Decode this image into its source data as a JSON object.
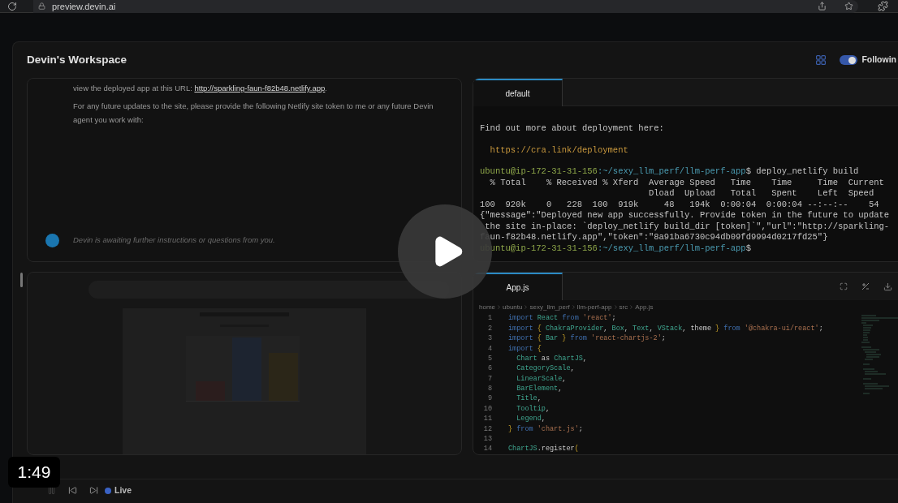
{
  "browser": {
    "url": "preview.devin.ai"
  },
  "workspace": {
    "title": "Devin's Workspace",
    "following": {
      "label": "Followin",
      "on": true
    }
  },
  "chat": {
    "paragraphs": [
      {
        "text": "view the deployed app at this URL: ",
        "link": "http://sparkling-faun-f82b48.netlify.app",
        "after": "."
      },
      {
        "text": "For any future updates to the site, please provide the following Netlify site token to me or any future Devin agent you work with:"
      }
    ],
    "status": "Devin is awaiting further instructions or questions from you."
  },
  "terminal": {
    "tabs": [
      {
        "label": "default",
        "selected": true
      }
    ],
    "lines": [
      {
        "kind": "text",
        "text": "Find out more about deployment here:"
      },
      {
        "kind": "link",
        "text": "  https://cra.link/deployment"
      },
      {
        "kind": "prompt",
        "user": "ubuntu@ip-172-31-31-156",
        "path": ":~/sexy_llm_perf/llm-perf-app",
        "text": "$ deploy_netlify build"
      },
      {
        "kind": "text",
        "text": "  % Total    % Received % Xferd  Average Speed   Time    Time     Time  Current"
      },
      {
        "kind": "text",
        "text": "                                 Dload  Upload   Total   Spent    Left  Speed"
      },
      {
        "kind": "text",
        "text": "100  920k    0   228  100  919k     48   194k  0:00:04  0:00:04 --:--:--    54"
      },
      {
        "kind": "text",
        "text": "{\"message\":\"Deployed new app successfully. Provide token in the future to update"
      },
      {
        "kind": "text",
        "text": " the site in-place: `deploy_netlify build_dir [token]`\",\"url\":\"http://sparkling-"
      },
      {
        "kind": "text",
        "text": "faun-f82b48.netlify.app\",\"token\":\"8a91ba6730c94db09fd9994d0217fd25\"}"
      },
      {
        "kind": "prompt",
        "user": "ubuntu@ip-172-31-31-156",
        "path": ":~/sexy_llm_perf/llm-perf-app",
        "text": "$"
      }
    ]
  },
  "editor": {
    "tabs": [
      {
        "label": "App.js",
        "selected": true
      }
    ],
    "breadcrumb": [
      "home",
      "ubuntu",
      "sexy_llm_perf",
      "llm-perf-app",
      "src",
      "App.js"
    ],
    "lines": [
      {
        "number": "1",
        "tokens": [
          {
            "kind": "keyword",
            "text": "import "
          },
          {
            "kind": "ident",
            "text": "React "
          },
          {
            "kind": "keyword",
            "text": "from "
          },
          {
            "kind": "string",
            "text": "'react'"
          },
          {
            "kind": "plain",
            "text": ";"
          }
        ]
      },
      {
        "number": "2",
        "tokens": [
          {
            "kind": "keyword",
            "text": "import "
          },
          {
            "kind": "brace",
            "text": "{ "
          },
          {
            "kind": "ident",
            "text": "ChakraProvider"
          },
          {
            "kind": "plain",
            "text": ", "
          },
          {
            "kind": "ident",
            "text": "Box"
          },
          {
            "kind": "plain",
            "text": ", "
          },
          {
            "kind": "ident",
            "text": "Text"
          },
          {
            "kind": "plain",
            "text": ", "
          },
          {
            "kind": "ident",
            "text": "VStack"
          },
          {
            "kind": "plain",
            "text": ", theme "
          },
          {
            "kind": "brace",
            "text": "} "
          },
          {
            "kind": "keyword",
            "text": "from "
          },
          {
            "kind": "string",
            "text": "'@chakra-ui/react'"
          },
          {
            "kind": "plain",
            "text": ";"
          }
        ]
      },
      {
        "number": "3",
        "tokens": [
          {
            "kind": "keyword",
            "text": "import "
          },
          {
            "kind": "brace",
            "text": "{ "
          },
          {
            "kind": "ident",
            "text": "Bar "
          },
          {
            "kind": "brace",
            "text": "} "
          },
          {
            "kind": "keyword",
            "text": "from "
          },
          {
            "kind": "string",
            "text": "'react-chartjs-2'"
          },
          {
            "kind": "plain",
            "text": ";"
          }
        ]
      },
      {
        "number": "4",
        "tokens": [
          {
            "kind": "keyword",
            "text": "import "
          },
          {
            "kind": "brace",
            "text": "{"
          }
        ]
      },
      {
        "number": "5",
        "tokens": [
          {
            "kind": "ident",
            "text": "  Chart "
          },
          {
            "kind": "plain",
            "text": "as "
          },
          {
            "kind": "ident",
            "text": "ChartJS"
          },
          {
            "kind": "plain",
            "text": ","
          }
        ]
      },
      {
        "number": "6",
        "tokens": [
          {
            "kind": "ident",
            "text": "  CategoryScale"
          },
          {
            "kind": "plain",
            "text": ","
          }
        ]
      },
      {
        "number": "7",
        "tokens": [
          {
            "kind": "ident",
            "text": "  LinearScale"
          },
          {
            "kind": "plain",
            "text": ","
          }
        ]
      },
      {
        "number": "8",
        "tokens": [
          {
            "kind": "ident",
            "text": "  BarElement"
          },
          {
            "kind": "plain",
            "text": ","
          }
        ]
      },
      {
        "number": "9",
        "tokens": [
          {
            "kind": "ident",
            "text": "  Title"
          },
          {
            "kind": "plain",
            "text": ","
          }
        ]
      },
      {
        "number": "10",
        "tokens": [
          {
            "kind": "ident",
            "text": "  Tooltip"
          },
          {
            "kind": "plain",
            "text": ","
          }
        ]
      },
      {
        "number": "11",
        "tokens": [
          {
            "kind": "ident",
            "text": "  Legend"
          },
          {
            "kind": "plain",
            "text": ","
          }
        ]
      },
      {
        "number": "12",
        "tokens": [
          {
            "kind": "brace",
            "text": "} "
          },
          {
            "kind": "keyword",
            "text": "from "
          },
          {
            "kind": "string",
            "text": "'chart.js'"
          },
          {
            "kind": "plain",
            "text": ";"
          }
        ]
      },
      {
        "number": "13"
      },
      {
        "number": "14",
        "tokens": [
          {
            "kind": "ident",
            "text": "ChartJS"
          },
          {
            "kind": "plain",
            "text": ".register"
          },
          {
            "kind": "brace",
            "text": "("
          }
        ]
      }
    ]
  },
  "player": {
    "live": "Live",
    "time": "1:49"
  }
}
